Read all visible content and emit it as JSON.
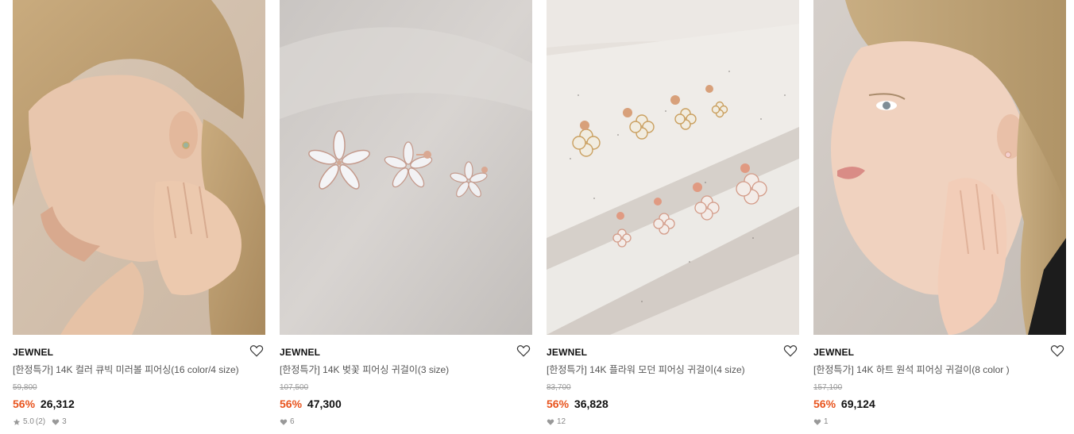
{
  "products": [
    {
      "brand": "JEWNEL",
      "title": "[한정특가] 14K 컬러 큐빅 미러볼 피어싱(16 color/4 size)",
      "original_price": "59,800",
      "discount": "56%",
      "sale_price": "26,312",
      "rating": "5.0",
      "reviews": "(2)",
      "likes": "3",
      "image": "woman-wearing-earring"
    },
    {
      "brand": "JEWNEL",
      "title": "[한정특가] 14K 벚꽃 피어싱 귀걸이(3 size)",
      "original_price": "107,500",
      "discount": "56%",
      "sale_price": "47,300",
      "likes": "6",
      "image": "flower-earrings"
    },
    {
      "brand": "JEWNEL",
      "title": "[한정특가] 14K 플라워 모던 피어싱 귀걸이(4 size)",
      "original_price": "83,700",
      "discount": "56%",
      "sale_price": "36,828",
      "likes": "12",
      "image": "flower-earrings-on-stone"
    },
    {
      "brand": "JEWNEL",
      "title": "[한정특가] 14K 하트 원석 피어싱 귀걸이(8 color )",
      "original_price": "157,100",
      "discount": "56%",
      "sale_price": "69,124",
      "likes": "1",
      "image": "woman-wearing-heart-earring"
    }
  ],
  "icons": {
    "wishlist": "heart-outline-icon",
    "rating": "star-icon",
    "likes": "heart-filled-icon"
  },
  "colors": {
    "discount": "#e8541e",
    "muted": "#999999"
  }
}
